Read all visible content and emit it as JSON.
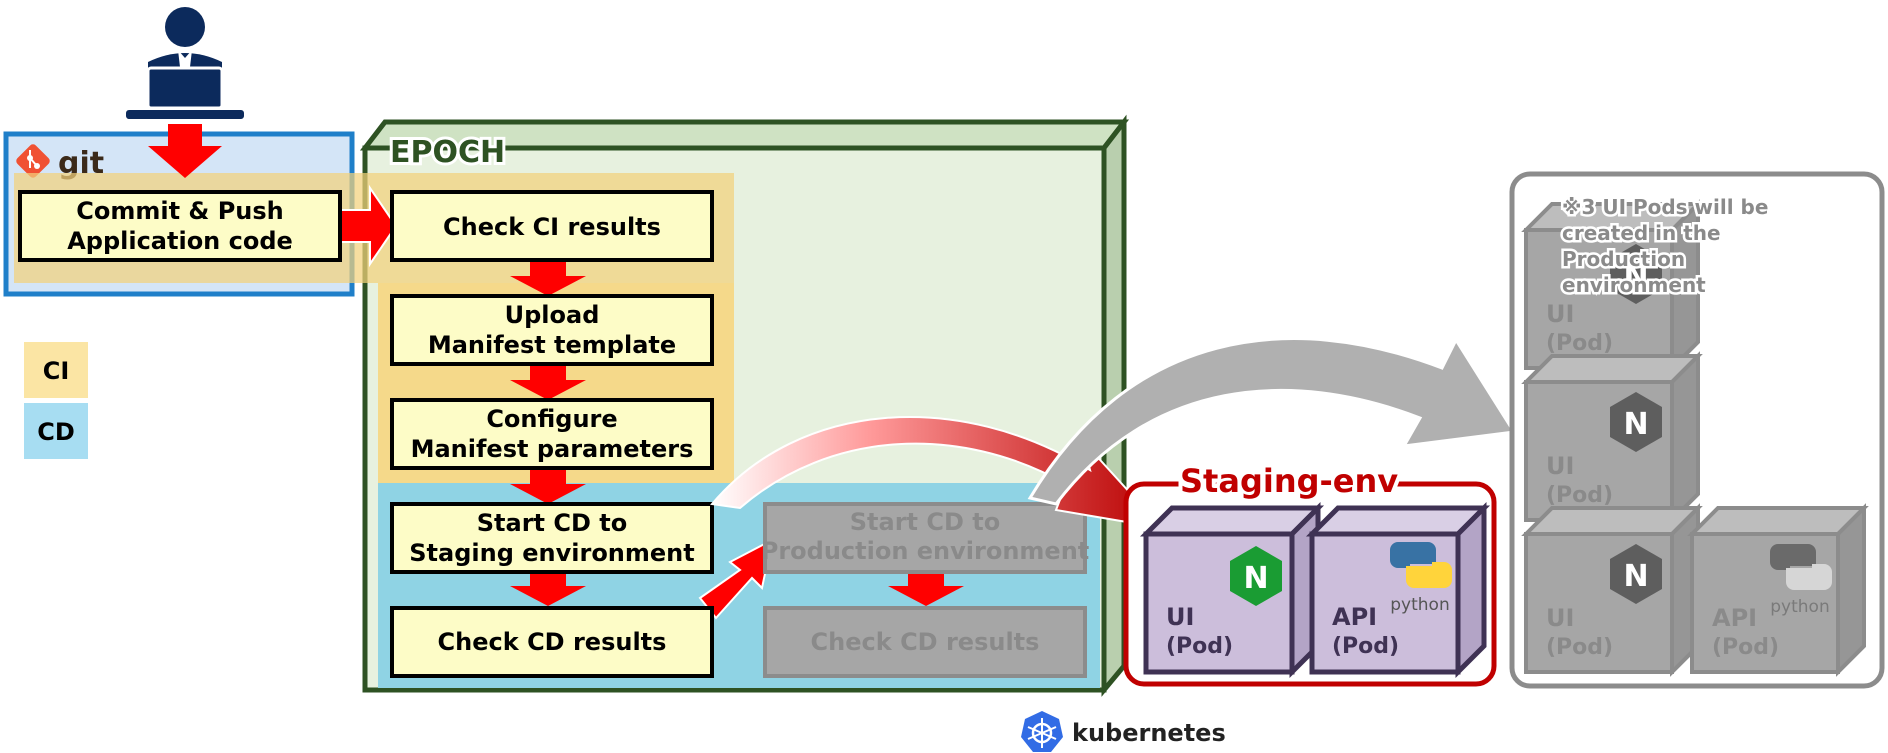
{
  "git_label": "git",
  "epoch_label": "EPOCH",
  "legend": [
    {
      "label": "CI",
      "color": "#fbe5a4"
    },
    {
      "label": "CD",
      "color": "#a7ddf2"
    }
  ],
  "commit_box": [
    "Commit & Push",
    "Application code"
  ],
  "ci_steps": [
    [
      "Check CI results"
    ],
    [
      "Upload",
      "Manifest template"
    ],
    [
      "Configure",
      "Manifest parameters"
    ]
  ],
  "cd_staging_steps": [
    [
      "Start CD to",
      "Staging environment"
    ],
    [
      "Check CD results"
    ]
  ],
  "cd_production_steps": [
    [
      "Start CD to",
      "Production environment"
    ],
    [
      "Check CD results"
    ]
  ],
  "staging_title": "Staging-env",
  "pods": {
    "ui": [
      "UI",
      "(Pod)"
    ],
    "api": [
      "API",
      "(Pod)"
    ],
    "nginx_letter": "N",
    "python_label": "python"
  },
  "production_note": [
    "※3 UI Pods will be",
    "created in the",
    "Production",
    "environment"
  ],
  "kubernetes_label": "kubernetes",
  "colors": {
    "git_blue": "#1f7fc9",
    "git_fill": "#d4e5f7",
    "epoch_green": "#2e5223",
    "epoch_fill": "#e7f1df",
    "ci_fill": "#f5d98a",
    "cd_fill": "#8fd3e4",
    "step_fill": "#fdfcc7",
    "arrow_red": "#ff0000",
    "staging_red": "#c00000",
    "pod_purple": "#ccbedb",
    "pod_border": "#3f3254",
    "grey_box": "#a6a6a6",
    "grey_text": "#8a8a8a",
    "nginx_green": "#1a9c33",
    "k8s_blue": "#326ce5"
  }
}
